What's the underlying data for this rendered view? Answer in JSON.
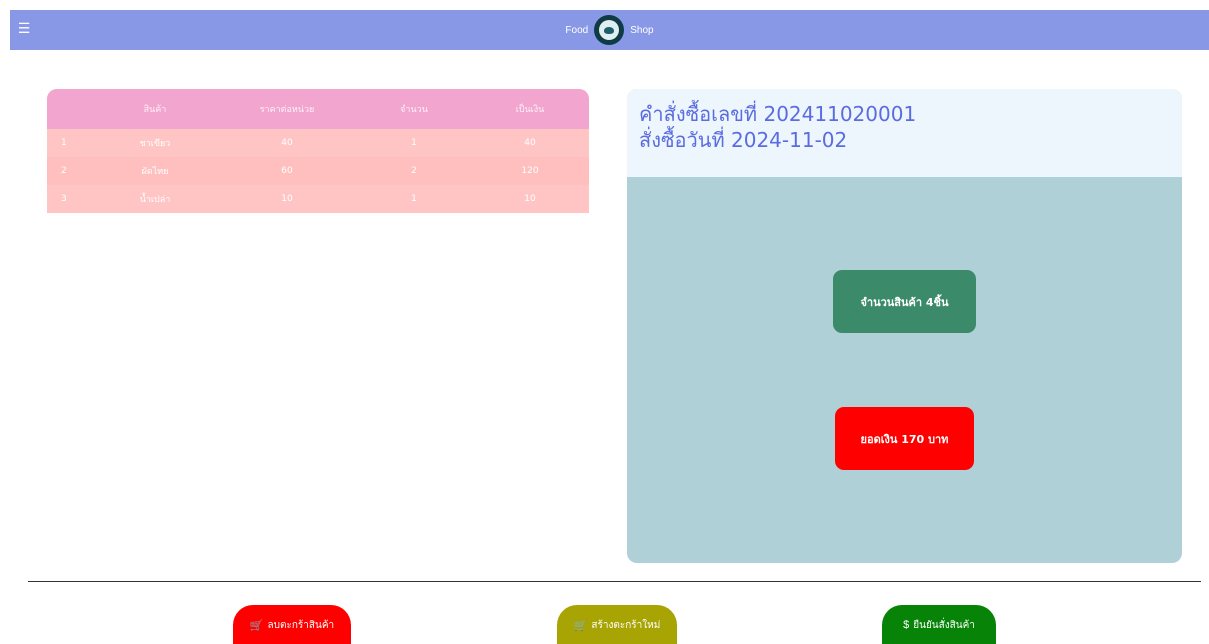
{
  "navbar": {
    "menu_icon": "hamburger-icon",
    "brand_left": "Food",
    "brand_right": "Shop",
    "logo_icon": "bowl-logo-icon"
  },
  "cart_table": {
    "headers": [
      "",
      "สินค้า",
      "ราคาต่อหน่วย",
      "จำนวน",
      "เป็นเงิน"
    ],
    "rows": [
      {
        "no": "1",
        "name": "ชาเขียว",
        "price": "40",
        "qty": "1",
        "amount": "40"
      },
      {
        "no": "2",
        "name": "ผัดไทย",
        "price": "60",
        "qty": "2",
        "amount": "120"
      },
      {
        "no": "3",
        "name": "น้ำเปล่า",
        "price": "10",
        "qty": "1",
        "amount": "10"
      }
    ]
  },
  "order_summary": {
    "order_line": "คำสั่งซื้อเลขที่ 202411020001",
    "date_line": "สั่งซื้อวันที่ 2024-11-02",
    "quantity_label": "จำนวนสินค้า 4ชิ้น",
    "total_label": "ยอดเงิน 170 บาท"
  },
  "actions": {
    "clear_cart": "ลบตะกร้าสินค้า",
    "new_cart": "สร้างตะกร้าใหม่",
    "confirm": "ยืนยันสั่งสินค้า",
    "cart_icon": "🛒",
    "dollar_icon": "$"
  },
  "colors": {
    "navbar": "#8898e6",
    "table_header": "#f2a6cf",
    "table_body": "#ffc5c5",
    "card_body": "#b0d0d7",
    "quantity_badge": "#3b8a6a",
    "total_badge": "#ff0000",
    "clear_button": "#ff0000",
    "new_button": "#a8a404",
    "confirm_button": "#078407"
  }
}
